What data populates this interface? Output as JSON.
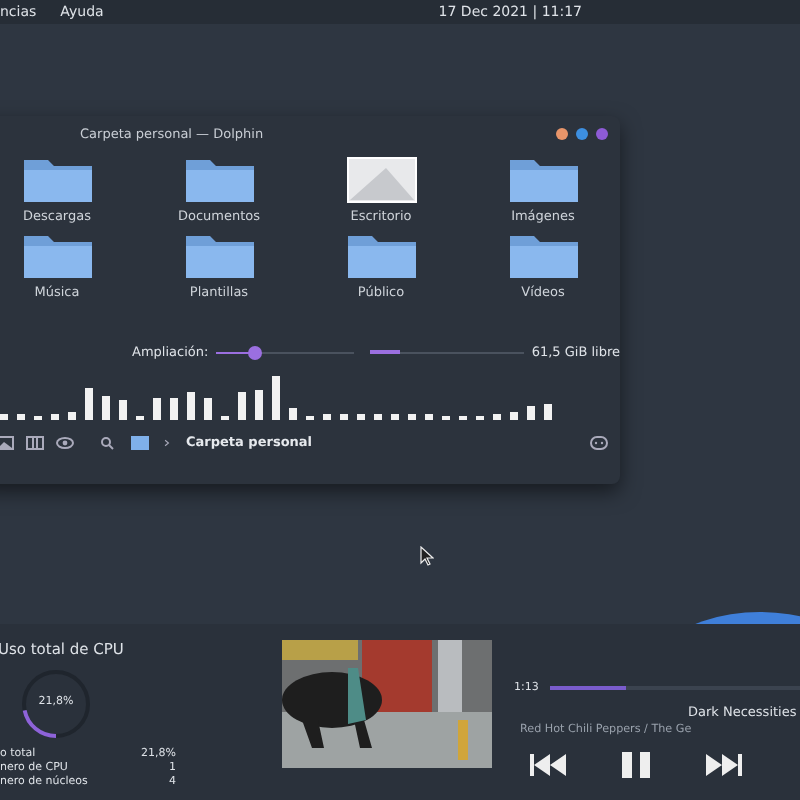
{
  "top_bar": {
    "menus": [
      "ncias",
      "Ayuda"
    ],
    "clock": "17 Dec 2021 | 11:17"
  },
  "window": {
    "title": "Carpeta personal — Dolphin",
    "window_buttons": [
      {
        "color": "#e8956a"
      },
      {
        "color": "#3d8fe0"
      },
      {
        "color": "#8e5bd6"
      }
    ],
    "items": [
      {
        "label": "Descargas",
        "kind": "folder"
      },
      {
        "label": "Documentos",
        "kind": "folder"
      },
      {
        "label": "Escritorio",
        "kind": "thumbnail"
      },
      {
        "label": "Imágenes",
        "kind": "folder"
      },
      {
        "label": "Música",
        "kind": "folder"
      },
      {
        "label": "Plantillas",
        "kind": "folder"
      },
      {
        "label": "Público",
        "kind": "folder"
      },
      {
        "label": "Vídeos",
        "kind": "folder"
      }
    ],
    "zoom": {
      "label": "Ampliación:",
      "level": 0.28
    },
    "space": {
      "level": 0.2,
      "reading": "61,5 GiB libre"
    },
    "breadcrumb": "Carpeta personal"
  },
  "cpu": {
    "title": "Uso total de CPU",
    "level": 0.218,
    "reading": "21,8%",
    "rows": [
      {
        "label": "o total",
        "value": "21,8%"
      },
      {
        "label": "nero de CPU",
        "value": "1"
      },
      {
        "label": "nero de núcleos",
        "value": "4"
      }
    ]
  },
  "player": {
    "time": "1:13",
    "level": 0.3,
    "title": "Dark Necessities",
    "artist": "Red Hot Chili Peppers / The Ge"
  }
}
